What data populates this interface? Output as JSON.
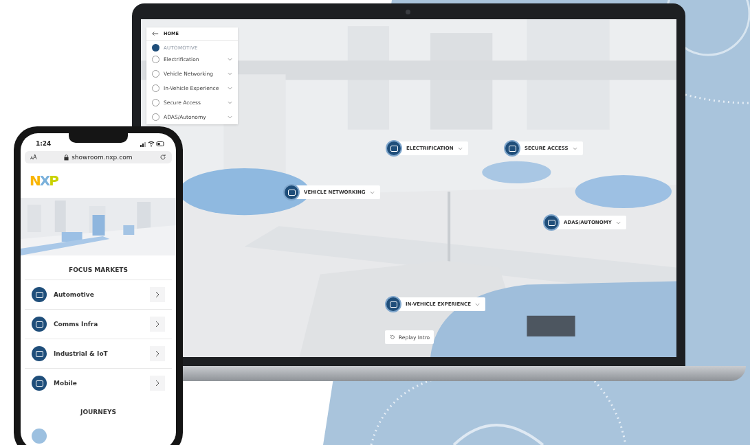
{
  "laptop": {
    "menu": {
      "back": "HOME",
      "section": "AUTOMOTIVE",
      "items": [
        {
          "label": "Electrification"
        },
        {
          "label": "Vehicle Networking"
        },
        {
          "label": "In-Vehicle Experience"
        },
        {
          "label": "Secure Access"
        },
        {
          "label": "ADAS/Autonomy"
        }
      ]
    },
    "hotspots": [
      {
        "label": "ELECTRIFICATION"
      },
      {
        "label": "SECURE ACCESS"
      },
      {
        "label": "VEHICLE NETWORKING"
      },
      {
        "label": "ADAS/AUTONOMY"
      },
      {
        "label": "IN-VEHICLE EXPERIENCE"
      }
    ],
    "replay_button": "Replay Intro"
  },
  "phone": {
    "time": "1:24",
    "text_size": "AA",
    "url": "showroom.nxp.com",
    "logo": "NXP",
    "sections": [
      {
        "title": "FOCUS MARKETS",
        "items": [
          {
            "label": "Automotive"
          },
          {
            "label": "Comms Infra"
          },
          {
            "label": "Industrial & IoT"
          },
          {
            "label": "Mobile"
          }
        ]
      },
      {
        "title": "JOURNEYS"
      }
    ]
  }
}
